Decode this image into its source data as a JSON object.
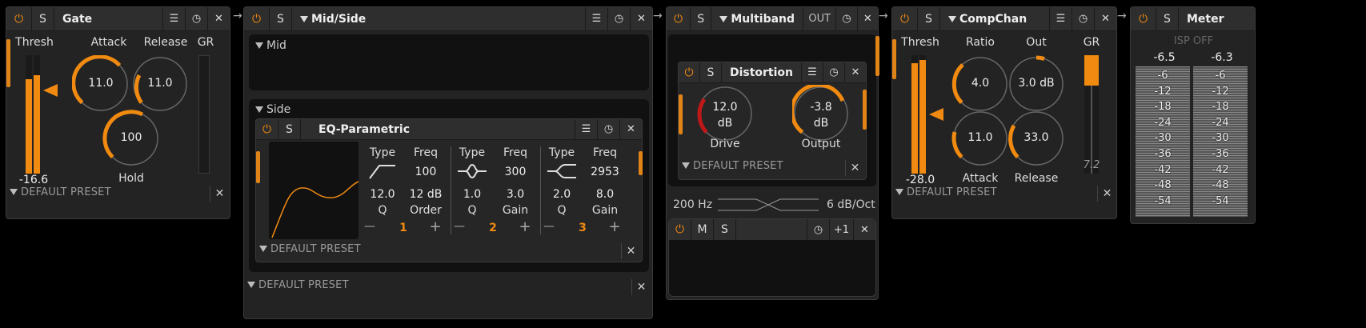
{
  "common": {
    "power": "⏻",
    "solo": "S",
    "close": "✕",
    "menu": "☰",
    "knob": "◷",
    "default_preset": "DEFAULT PRESET",
    "chain_arrow": "→"
  },
  "gate": {
    "title": "Gate",
    "thresh_label": "Thresh",
    "thresh_value": "-16.6",
    "attack_label": "Attack",
    "attack_value": "11.0",
    "release_label": "Release",
    "release_value": "11.0",
    "hold_label": "Hold",
    "hold_value": "100",
    "gr_label": "GR"
  },
  "midside": {
    "title": "Mid/Side",
    "mid_label": "Mid",
    "side_label": "Side"
  },
  "eq": {
    "title": "EQ-Parametric",
    "bands": [
      {
        "type_label": "Type",
        "freq_label": "Freq",
        "freq": "100",
        "q_value": "12.0",
        "q_label": "Q",
        "p2_value": "12 dB",
        "p2_label": "Order",
        "num": "1"
      },
      {
        "type_label": "Type",
        "freq_label": "Freq",
        "freq": "300",
        "q_value": "1.0",
        "q_label": "Q",
        "p2_value": "3.0",
        "p2_label": "Gain",
        "num": "2"
      },
      {
        "type_label": "Type",
        "freq_label": "Freq",
        "freq": "2953",
        "q_value": "2.0",
        "q_label": "Q",
        "p2_value": "8.0",
        "p2_label": "Gain",
        "num": "3"
      }
    ],
    "minus": "—",
    "plus": "+"
  },
  "multiband": {
    "title": "Multiband",
    "out_label": "OUT",
    "freq": "200 Hz",
    "slope": "6 dB/Oct",
    "mute": "M",
    "solo": "S",
    "plus_one": "+1"
  },
  "distortion": {
    "title": "Distortion",
    "drive_value": "12.0",
    "drive_unit": "dB",
    "drive_label": "Drive",
    "output_value": "-3.8",
    "output_unit": "dB",
    "output_label": "Output"
  },
  "compchan": {
    "title": "CompChan",
    "thresh_label": "Thresh",
    "thresh_value": "-28.0",
    "ratio_label": "Ratio",
    "ratio_value": "4.0",
    "out_label": "Out",
    "out_value": "3.0 dB",
    "attack_label": "Attack",
    "attack_value": "11.0",
    "release_label": "Release",
    "release_value": "33.0",
    "gr_label": "GR",
    "gr_value": "7.2"
  },
  "meter": {
    "title": "Meter",
    "isp": "ISP OFF",
    "left_peak": "-6.5",
    "right_peak": "-6.3",
    "scale": [
      "-6",
      "-12",
      "-18",
      "-24",
      "-30",
      "-36",
      "-42",
      "-48",
      "-54"
    ]
  }
}
